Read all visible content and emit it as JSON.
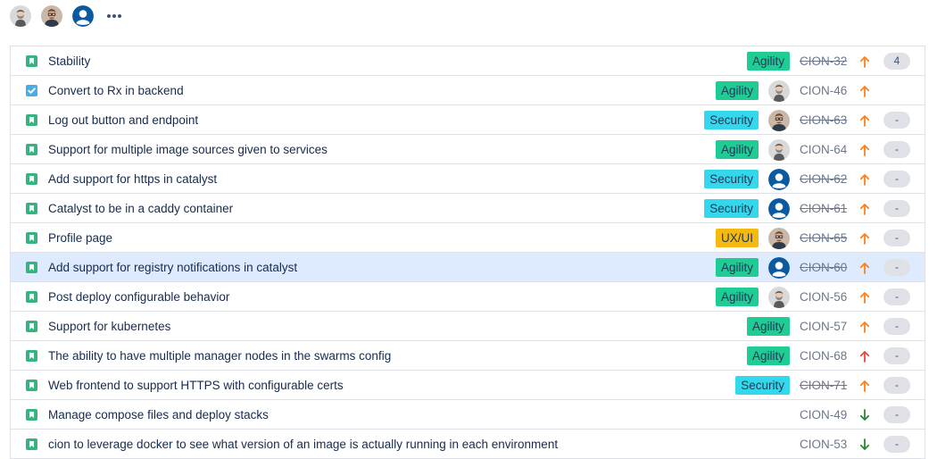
{
  "filter_avatars": [
    {
      "name": "bearded-user-avatar",
      "kind": "bearded"
    },
    {
      "name": "glasses-user-avatar",
      "kind": "glasses"
    },
    {
      "name": "default-user-avatar",
      "kind": "default"
    }
  ],
  "more_icon": "more-horizontal-icon",
  "colors": {
    "agility": "#1fcc93",
    "security": "#34d8ec",
    "uxui": "#f5b90f",
    "story_icon": "#36b37e",
    "task_icon": "#4bade8",
    "priority_high": "#ff7f1a",
    "priority_highest": "#e5493a",
    "priority_low": "#2a8735",
    "selected_row": "#deebff"
  },
  "issues": [
    {
      "summary": "Stability",
      "type": "story",
      "label": "Agility",
      "assignee": "",
      "key": "CION-32",
      "done": true,
      "priority": "high",
      "estimate": "4"
    },
    {
      "summary": "Convert to Rx in backend",
      "type": "task",
      "label": "Agility",
      "assignee": "bearded",
      "key": "CION-46",
      "done": false,
      "priority": "high",
      "estimate": ""
    },
    {
      "summary": "Log out button and endpoint",
      "type": "story",
      "label": "Security",
      "assignee": "glasses",
      "key": "CION-63",
      "done": true,
      "priority": "high",
      "estimate": "-"
    },
    {
      "summary": "Support for multiple image sources given to services",
      "type": "story",
      "label": "Agility",
      "assignee": "bearded",
      "key": "CION-64",
      "done": false,
      "priority": "high",
      "estimate": "-"
    },
    {
      "summary": "Add support for https in catalyst",
      "type": "story",
      "label": "Security",
      "assignee": "default",
      "key": "CION-62",
      "done": true,
      "priority": "high",
      "estimate": "-"
    },
    {
      "summary": "Catalyst to be in a caddy container",
      "type": "story",
      "label": "Security",
      "assignee": "default",
      "key": "CION-61",
      "done": true,
      "priority": "high",
      "estimate": "-"
    },
    {
      "summary": "Profile page",
      "type": "story",
      "label": "UX/UI",
      "assignee": "glasses",
      "key": "CION-65",
      "done": true,
      "priority": "high",
      "estimate": "-"
    },
    {
      "summary": "Add support for registry notifications in catalyst",
      "type": "story",
      "label": "Agility",
      "assignee": "default",
      "key": "CION-60",
      "done": true,
      "priority": "high",
      "estimate": "-",
      "selected": true
    },
    {
      "summary": "Post deploy configurable behavior",
      "type": "story",
      "label": "Agility",
      "assignee": "bearded",
      "key": "CION-56",
      "done": false,
      "priority": "high",
      "estimate": "-"
    },
    {
      "summary": "Support for kubernetes",
      "type": "story",
      "label": "Agility",
      "assignee": "",
      "key": "CION-57",
      "done": false,
      "priority": "high",
      "estimate": "-"
    },
    {
      "summary": "The ability to have multiple manager nodes in the swarms config",
      "type": "story",
      "label": "Agility",
      "assignee": "",
      "key": "CION-68",
      "done": false,
      "priority": "highest",
      "estimate": "-"
    },
    {
      "summary": "Web frontend to support HTTPS with configurable certs",
      "type": "story",
      "label": "Security",
      "assignee": "",
      "key": "CION-71",
      "done": true,
      "priority": "high",
      "estimate": "-"
    },
    {
      "summary": "Manage compose files and deploy stacks",
      "type": "story",
      "label": "",
      "assignee": "",
      "key": "CION-49",
      "done": false,
      "priority": "low",
      "estimate": "-"
    },
    {
      "summary": "cion to leverage docker to see what version of an image is actually running in each environment",
      "type": "story",
      "label": "",
      "assignee": "",
      "key": "CION-53",
      "done": false,
      "priority": "low",
      "estimate": "-"
    }
  ]
}
